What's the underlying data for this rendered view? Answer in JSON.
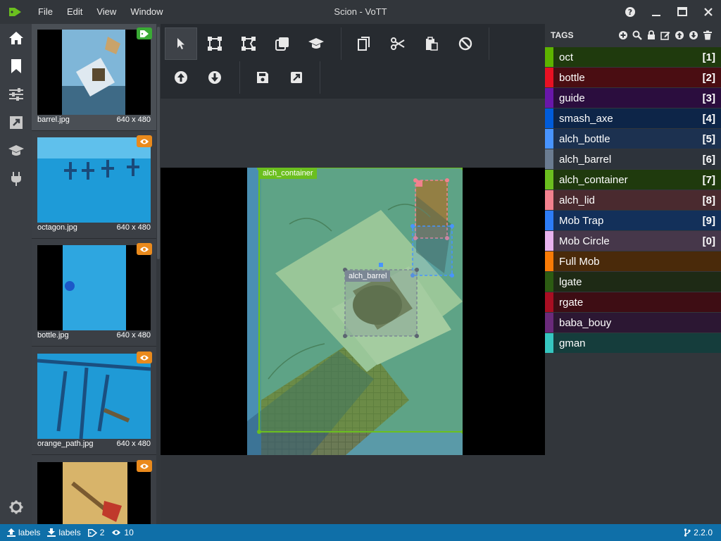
{
  "window": {
    "title": "Scion - VoTT"
  },
  "menu": [
    "File",
    "Edit",
    "View",
    "Window"
  ],
  "assets": [
    {
      "name": "barrel.jpg",
      "size": "640 x 480",
      "state": "tagged"
    },
    {
      "name": "octagon.jpg",
      "size": "640 x 480",
      "state": "visited"
    },
    {
      "name": "bottle.jpg",
      "size": "640 x 480",
      "state": "visited"
    },
    {
      "name": "orange_path.jpg",
      "size": "640 x 480",
      "state": "visited"
    },
    {
      "name": "",
      "size": "",
      "state": "visited"
    }
  ],
  "regions": [
    {
      "tag": "alch_container",
      "color": "#6bbf1f"
    },
    {
      "tag": "alch_barrel",
      "color": "#7b8794"
    }
  ],
  "tags_panel": {
    "title": "TAGS",
    "tags": [
      {
        "name": "oct",
        "key": "[1]",
        "color": "#5db300",
        "bg": "#1f3a0d"
      },
      {
        "name": "bottle",
        "key": "[2]",
        "color": "#e81123",
        "bg": "#4a0d12"
      },
      {
        "name": "guide",
        "key": "[3]",
        "color": "#6917aa",
        "bg": "#2b0d3e"
      },
      {
        "name": "smash_axe",
        "key": "[4]",
        "color": "#015cda",
        "bg": "#0d2548"
      },
      {
        "name": "alch_bottle",
        "key": "[5]",
        "color": "#4894fe",
        "bg": "#1c3150"
      },
      {
        "name": "alch_barrel",
        "key": "[6]",
        "color": "#6b7c91",
        "bg": "#2d333b"
      },
      {
        "name": "alch_container",
        "key": "[7]",
        "color": "#6bbf1f",
        "bg": "#1f3a0d"
      },
      {
        "name": "alch_lid",
        "key": "[8]",
        "color": "#f2818e",
        "bg": "#4a2a2f"
      },
      {
        "name": "Mob Trap",
        "key": "[9]",
        "color": "#2d7cf6",
        "bg": "#13305a"
      },
      {
        "name": "Mob Circle",
        "key": "[0]",
        "color": "#e8b3ee",
        "bg": "#46374a"
      },
      {
        "name": "Full Mob",
        "key": "",
        "color": "#f97b06",
        "bg": "#4a2a0a"
      },
      {
        "name": "lgate",
        "key": "",
        "color": "#2c5b12",
        "bg": "#1e2a15"
      },
      {
        "name": "rgate",
        "key": "",
        "color": "#a80e22",
        "bg": "#3e0d14"
      },
      {
        "name": "baba_bouy",
        "key": "",
        "color": "#6a2a7a",
        "bg": "#2c1733"
      },
      {
        "name": "gman",
        "key": "",
        "color": "#36c6c0",
        "bg": "#153d3c"
      }
    ]
  },
  "status": {
    "source": "labels",
    "target": "labels",
    "tagged_count": "2",
    "visited_count": "10",
    "version": "2.2.0"
  },
  "icons": {
    "logo": "tag-logo-icon",
    "nav": [
      "home-icon",
      "bookmark-icon",
      "settings-sliders-icon",
      "export-icon",
      "active-learning-icon",
      "plug-icon"
    ],
    "toolbar": [
      "select-pointer-icon",
      "draw-rectangle-icon",
      "draw-polygon-icon",
      "copy-rectangle-icon",
      "active-learning-icon",
      "copy-regions-icon",
      "cut-regions-icon",
      "paste-regions-icon",
      "clear-regions-icon",
      "previous-asset-icon",
      "next-asset-icon",
      "save-icon",
      "export-icon"
    ]
  }
}
